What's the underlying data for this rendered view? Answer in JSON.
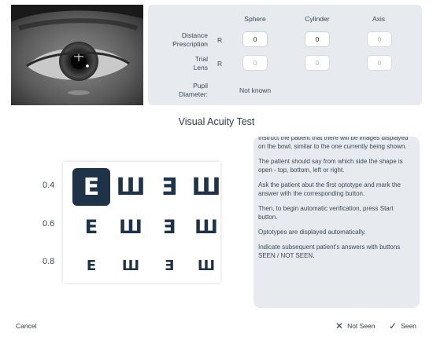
{
  "prescription": {
    "columns": [
      "Sphere",
      "Cylinder",
      "Axis"
    ],
    "rows": [
      {
        "label_line1": "Distance",
        "label_line2": "Prescription",
        "side": "R",
        "values": [
          "0",
          "0",
          "0"
        ]
      },
      {
        "label_line1": "Trial",
        "label_line2": "Lens",
        "side": "R",
        "values": [
          "0",
          "0",
          "0"
        ]
      }
    ],
    "pupil": {
      "label_line1": "Pupil",
      "label_line2": "Diameter:",
      "value": "Not known"
    }
  },
  "title": "Visual Acuity Test",
  "chart": {
    "rows": [
      {
        "acuity": "0.4",
        "optotypes": [
          "E",
          "Ш",
          "Ǝ",
          "Ш"
        ]
      },
      {
        "acuity": "0.6",
        "optotypes": [
          "E",
          "Ш",
          "Ǝ",
          "Ш"
        ]
      },
      {
        "acuity": "0.8",
        "optotypes": [
          "E",
          "Ш",
          "Ǝ",
          "Ш"
        ]
      }
    ],
    "selected": {
      "row": 0,
      "col": 0
    }
  },
  "instructions": [
    "Instruct the patient that there will be images displayed on the bowl, similar to the one currently being shown.",
    "The patient should say from which side the shape is open - top, bottom, left or right.",
    "Ask the patient abut the first optotype and mark the answer with the corresponding button.",
    "Then, to begin automatic verification, press Start button.",
    "Optotypes are displayed automatically.",
    "Indicate subsequent patient's answers with buttons SEEN / NOT SEEN."
  ],
  "footer": {
    "cancel_label": "Cancel",
    "not_seen_label": "Not Seen",
    "seen_label": "Seen"
  },
  "icons": {
    "not_seen": "close-icon",
    "seen": "check-icon"
  },
  "colors": {
    "accent": "#1f3348",
    "panel": "#e7ebf0",
    "muted_value": "#9fb9cf"
  }
}
